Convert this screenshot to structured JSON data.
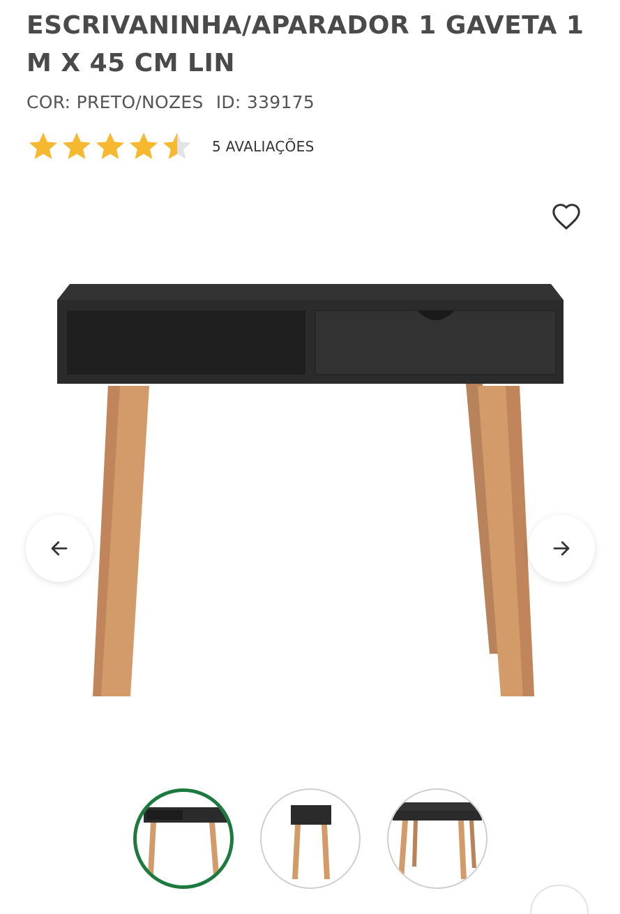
{
  "product": {
    "title": "ESCRIVANINHA/APARADOR 1 GAVETA 1 M X 45 CM LIN",
    "color_label": "COR: PRETO/NOZES",
    "id_label": "ID: 339175",
    "rating_value": 4.5,
    "rating_max": 5,
    "reviews_label": "5 AVALIAÇÕES"
  },
  "icons": {
    "favorite": "heart-outline-icon",
    "prev": "arrow-left-icon",
    "next": "arrow-right-icon",
    "star": "star-icon"
  },
  "colors": {
    "star": "#f5b82e",
    "star_empty": "#e4e4e4",
    "active_thumb_border": "#1d7a3f",
    "furniture_body": "#2b2b2b",
    "legs": "#d39a6a"
  },
  "gallery": {
    "thumbnail_count": 3,
    "active_index": 0
  }
}
